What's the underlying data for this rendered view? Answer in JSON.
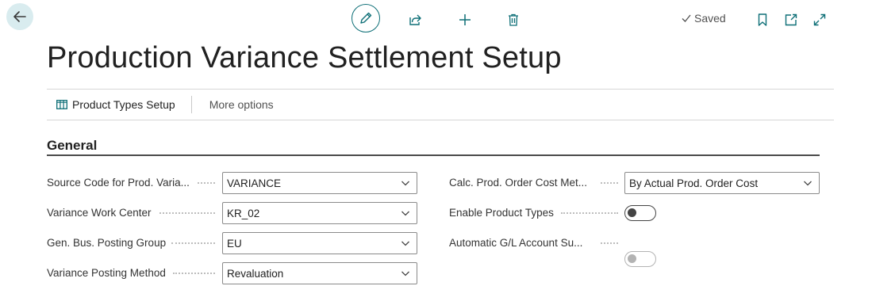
{
  "toolbar": {
    "saved_label": "Saved"
  },
  "page": {
    "title": "Production Variance Settlement Setup"
  },
  "actions": {
    "product_types_setup": "Product Types Setup",
    "more_options": "More options"
  },
  "section": {
    "title": "General"
  },
  "fields": {
    "source_code": {
      "label": "Source Code for Prod. Varia...",
      "value": "VARIANCE"
    },
    "variance_work_center": {
      "label": "Variance Work Center",
      "value": "KR_02"
    },
    "gen_bus_posting_group": {
      "label": "Gen. Bus. Posting Group",
      "value": "EU"
    },
    "variance_posting_method": {
      "label": "Variance Posting Method",
      "value": "Revaluation"
    },
    "calc_prod_order_cost": {
      "label": "Calc. Prod. Order Cost Met...",
      "value": "By Actual Prod. Order Cost"
    },
    "enable_product_types": {
      "label": "Enable Product Types",
      "value": "off"
    },
    "automatic_gl_account": {
      "label": "Automatic G/L Account Su...",
      "value": "off"
    }
  },
  "colors": {
    "accent": "#0e6f77",
    "back_button_bg": "#d9ecef"
  }
}
